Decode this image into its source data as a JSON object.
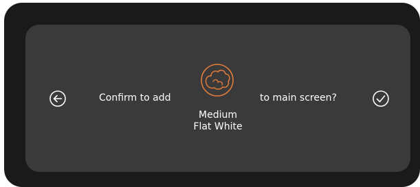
{
  "dialog": {
    "prompt_before": "Confirm to add",
    "prompt_after": "to main screen?",
    "drink": {
      "size": "Medium",
      "name": "Flat White",
      "icon": "flat-white-drink-icon"
    },
    "back_icon": "arrow-left-circle-icon",
    "confirm_icon": "check-circle-icon",
    "accent_color": "#e07b3c"
  }
}
